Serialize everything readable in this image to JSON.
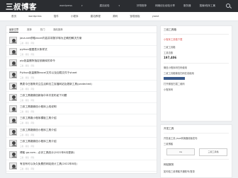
{
  "header": {
    "logo": "三叔博客",
    "nav": [
      {
        "label": "wordpress",
        "has_menu": true
      },
      {
        "label": "建站经验",
        "has_menu": true
      },
      {
        "label": "好物推荐",
        "has_menu": false
      },
      {
        "label": "网赚创业经验分享",
        "has_menu": false
      },
      {
        "label": "服务器",
        "has_menu": false
      },
      {
        "label": "搜索",
        "has_menu": true
      }
    ],
    "right_link": "小程序工具"
  },
  "subnav": {
    "tabs": [
      "首页",
      "wordpress",
      "插件",
      "小程序",
      "建站教程",
      "源码",
      "宝塔面板",
      "yoast"
    ]
  },
  "main": {
    "tabs": [
      "最新文章",
      "推荐",
      "热门",
      "随机推荐"
    ],
    "active_tab": 0,
    "articles": [
      {
        "title": "java.net获取excel内容并将数字转为正确的解决方案",
        "meta": "三叔 · 阅读 · 评论"
      },
      {
        "title": "python做图表头条样式",
        "meta": "三叔 · 阅读 · 评论"
      },
      {
        "title": "pip批量删除指定依赖库的命令",
        "meta": "三叔 · 阅读 · 评论"
      },
      {
        "title": "Python批量删除excel文件以及加载文件于sheet",
        "meta": "三叔 · 阅读 · 评论"
      },
      {
        "title": "黑麦今日推荐关注生活和法兰克福网站及更新工具(protected)",
        "meta": "三叔 · 阅读 · 评论"
      },
      {
        "title": "三叔工具箱微信新版中本次发布如下问题",
        "meta": "三叔 · 阅读 · 评论"
      },
      {
        "title": "三叔工具箱微信小程序上线说明",
        "meta": "三叔 · 阅读 · 评论"
      },
      {
        "title": "三叔工具箱小程序模板工具介绍",
        "meta": "三叔 · 阅读 · 评论"
      },
      {
        "title": "三叔工具箱微信小程序工具介绍",
        "meta": "三叔 · 阅读 · 评论"
      },
      {
        "title": "三叔工具箱微信小程序工具介绍",
        "meta": "三叔 · 阅读 · 评论"
      },
      {
        "title": "博客 go.com...点评工具统计(2022年8月更新)",
        "meta": "三叔 · 阅读 · 评论"
      },
      {
        "title": "有没有可以永久免费的网站统计工具(2022年8月)",
        "meta": "三叔 · 阅读 · 评论"
      }
    ]
  },
  "sidebar": {
    "box1": {
      "title": "三叔工具箱",
      "subtitle": "小程序工具箱下载",
      "label_red": "三叔工具箱",
      "count_label": "工具总数",
      "count": "197,406",
      "qr_caption": "微信小程序码扫码使用",
      "promo_title": "三叔工具箱微信扫码在线使用",
      "promo_sub": "打开微信扫描二维码",
      "small_text": "小程序码"
    },
    "box2": {
      "title": "开发工具",
      "link1": "开发者工具 java转换器原版发布",
      "link2": "三叔博客",
      "btn1": "ios",
      "btn2": "三叔工具箱",
      "footer": "网站服务",
      "footer_link": "如何给三叔博客开通账号/登录"
    }
  }
}
